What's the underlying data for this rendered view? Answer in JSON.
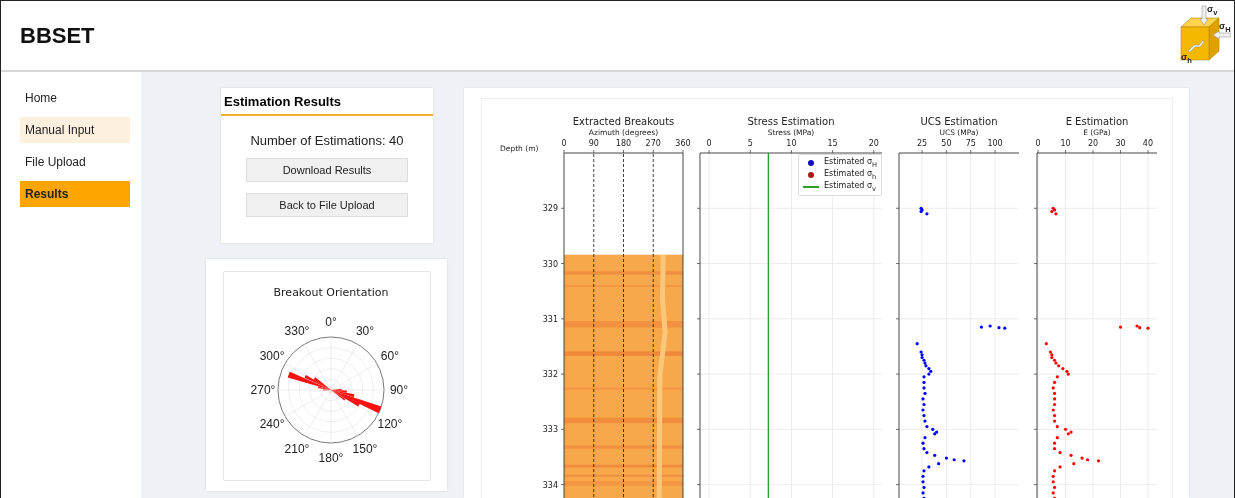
{
  "header": {
    "title": "BBSET",
    "logo_labels": [
      "σ$_{v}$",
      "σ$_{H}$",
      "σ$_{h}$"
    ]
  },
  "sidebar": {
    "items": [
      {
        "label": "Home",
        "selected": false,
        "hovered": false
      },
      {
        "label": "Manual Input",
        "selected": false,
        "hovered": true
      },
      {
        "label": "File Upload",
        "selected": false,
        "hovered": false
      },
      {
        "label": "Results",
        "selected": true,
        "hovered": false
      }
    ]
  },
  "results_card": {
    "title": "Estimation Results",
    "count_text": "Number of Estimations: 40",
    "buttons": [
      "Download Results",
      "Back to File Upload"
    ]
  },
  "orientation_card": {
    "title": "Breakout Orientation",
    "angle_labels": [
      "0°",
      "30°",
      "60°",
      "90°",
      "120°",
      "150°",
      "180°",
      "210°",
      "240°",
      "270°",
      "300°",
      "330°"
    ]
  },
  "figure": {
    "panels": [
      {
        "kind": "image",
        "title": "Extracted Breakouts",
        "xlabel": "Azimuth (degrees)",
        "ylabel": "Depth (m)",
        "xticks": [
          "0",
          "90",
          "180",
          "270",
          "360"
        ],
        "yticks": [
          "329",
          "330",
          "331",
          "332",
          "333",
          "334"
        ]
      },
      {
        "kind": "stress",
        "title": "Stress Estimation",
        "xlabel": "Stress (MPa)",
        "xticks": [
          "0",
          "5",
          "10",
          "15",
          "20"
        ],
        "legend": [
          {
            "kind": "dot",
            "label": "Estimated σ$_{H}$",
            "color": "#1010c0"
          },
          {
            "kind": "dot",
            "label": "Estimated σ$_{h}$",
            "color": "#b01818"
          },
          {
            "kind": "line",
            "label": "Estimated σ$_{v}$",
            "color": "#2ca02c"
          }
        ]
      },
      {
        "kind": "ucs",
        "title": "UCS Estimation",
        "xlabel": "UCS (MPa)",
        "xticks": [
          "25",
          "50",
          "75",
          "100"
        ]
      },
      {
        "kind": "modulus",
        "title": "E Estimation",
        "xlabel": "E (GPa)",
        "xticks": [
          "0",
          "10",
          "20",
          "30",
          "40"
        ]
      }
    ]
  }
}
